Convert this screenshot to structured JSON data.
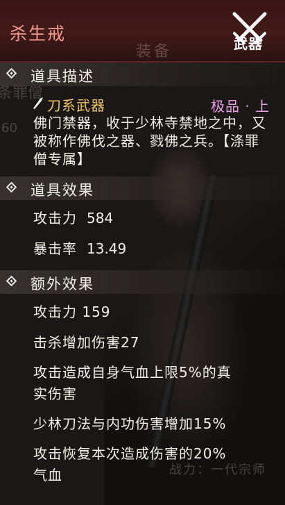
{
  "header": {
    "title": "杀生戒",
    "badge_label": "武器"
  },
  "background": {
    "header_word": "装备",
    "left_text": "条罪僧",
    "left_number": "60",
    "footer_text": "战力：一代宗师"
  },
  "sections": {
    "description": {
      "title": "道具描述",
      "weapon_type": "刀系武器",
      "quality": "极品 · 上",
      "text": "佛门禁器，收于少林寺禁地之中，又被称作佛伐之器、戮佛之兵。【涤罪僧专属】"
    },
    "effects": {
      "title": "道具效果",
      "stats": [
        {
          "label": "攻击力",
          "value": "584"
        },
        {
          "label": "暴击率",
          "value": "13.49"
        }
      ]
    },
    "extra": {
      "title": "额外效果",
      "lines": [
        "攻击力  159",
        "击杀增加伤害27",
        "攻击造成自身气血上限5%的真",
        "实伤害",
        "少林刀法与内功伤害增加15%",
        "攻击恢复本次造成伤害的20%",
        "气血"
      ]
    }
  },
  "colors": {
    "title": "#f19a8e",
    "weapon_type": "#f1c66a",
    "quality": "#e9a0e8",
    "header_bg": "#421a1a"
  }
}
